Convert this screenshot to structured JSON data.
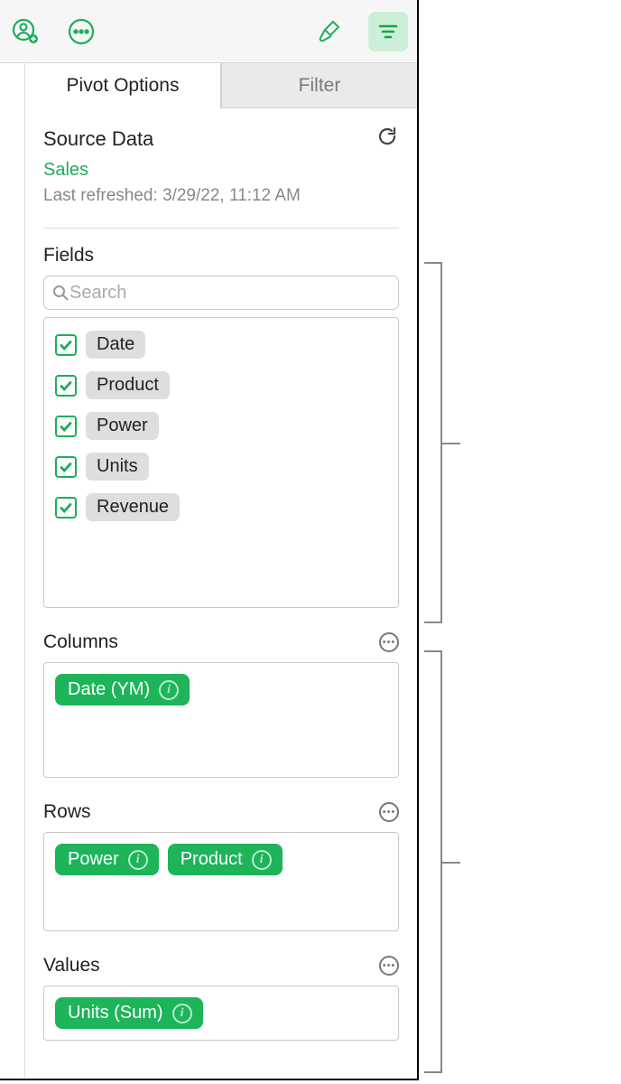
{
  "tabs": {
    "pivot": "Pivot Options",
    "filter": "Filter"
  },
  "source": {
    "heading": "Source Data",
    "name": "Sales",
    "refreshed": "Last refreshed: 3/29/22, 11:12 AM"
  },
  "fields": {
    "heading": "Fields",
    "search_placeholder": "Search",
    "items": [
      {
        "label": "Date",
        "checked": true
      },
      {
        "label": "Product",
        "checked": true
      },
      {
        "label": "Power",
        "checked": true
      },
      {
        "label": "Units",
        "checked": true
      },
      {
        "label": "Revenue",
        "checked": true
      }
    ]
  },
  "columns": {
    "heading": "Columns",
    "pills": [
      "Date (YM)"
    ]
  },
  "rows": {
    "heading": "Rows",
    "pills": [
      "Power",
      "Product"
    ]
  },
  "values": {
    "heading": "Values",
    "pills": [
      "Units (Sum)"
    ]
  }
}
